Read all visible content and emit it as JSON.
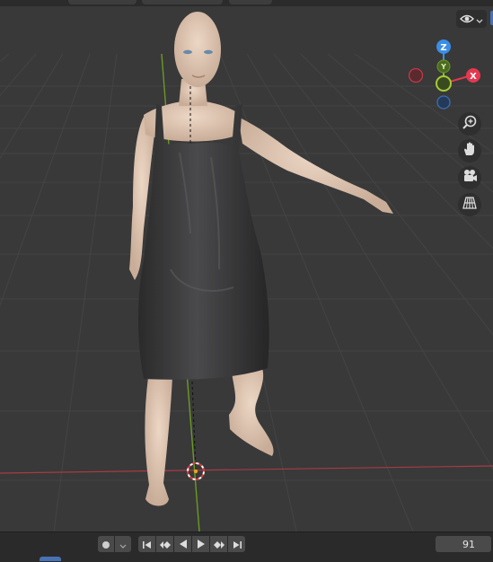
{
  "viewport": {
    "overlay_icon": "eye-icon",
    "gizmo": {
      "z_label": "Z",
      "x_label": "X",
      "y_label": "Y"
    },
    "nav_buttons": [
      {
        "name": "zoom-icon"
      },
      {
        "name": "hand-pan-icon"
      },
      {
        "name": "camera-icon"
      },
      {
        "name": "perspective-grid-icon"
      }
    ]
  },
  "timeline": {
    "current_frame": "91",
    "controls": [
      "jump-to-start",
      "previous-keyframe",
      "play-reverse",
      "play",
      "next-keyframe",
      "jump-to-end"
    ]
  },
  "colors": {
    "x_axis": "#e5384f",
    "y_axis": "#8bbf2d",
    "z_axis": "#3a8ee6",
    "accent": "#4772b3"
  }
}
